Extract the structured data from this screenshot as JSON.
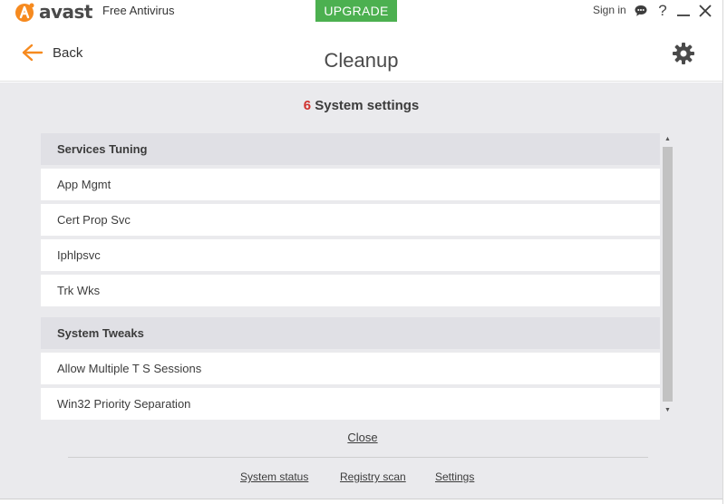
{
  "titlebar": {
    "brand": "avast",
    "product": "Free Antivirus",
    "upgrade_label": "UPGRADE",
    "signin_label": "Sign in",
    "help_glyph": "?",
    "icons": [
      "avast-logo-icon",
      "chat-icon",
      "help-icon",
      "minimize-icon",
      "close-icon"
    ]
  },
  "header": {
    "back_label": "Back",
    "title": "Cleanup",
    "icons": [
      "back-arrow-icon",
      "gear-icon"
    ]
  },
  "summary": {
    "count": "6",
    "label": "System settings"
  },
  "groups": [
    {
      "title": "Services Tuning",
      "items": [
        "App Mgmt",
        "Cert Prop Svc",
        "Iphlpsvc",
        "Trk Wks"
      ]
    },
    {
      "title": "System Tweaks",
      "items": [
        "Allow Multiple T S Sessions",
        "Win32 Priority Separation"
      ]
    }
  ],
  "actions": {
    "close_label": "Close"
  },
  "footer": {
    "system_status": "System status",
    "registry_scan": "Registry scan",
    "settings": "Settings"
  },
  "colors": {
    "brand_orange": "#f68a1f",
    "upgrade_green": "#4cb050",
    "count_red": "#d0312d",
    "content_bg": "#eaeaed",
    "group_header_bg": "#e0e0e5"
  }
}
